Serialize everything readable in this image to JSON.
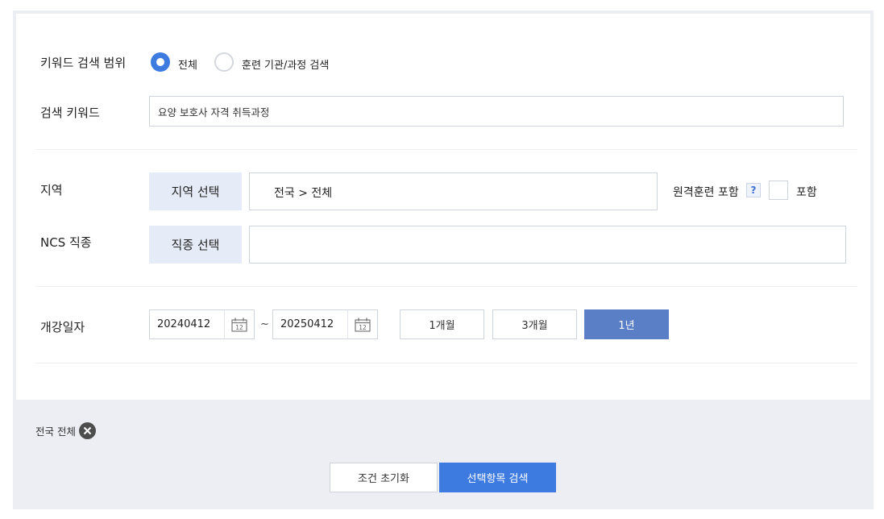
{
  "scope": {
    "label": "키워드 검색 범위",
    "options": [
      {
        "label": "전체",
        "selected": true
      },
      {
        "label": "훈련 기관/과정 검색",
        "selected": false
      }
    ]
  },
  "keyword": {
    "label": "검색 키워드",
    "value": "요양 보호사 자격 취득과정"
  },
  "region": {
    "label": "지역",
    "button": "지역 선택",
    "value": "전국 > 전체",
    "remote_label": "원격훈련 포함",
    "help": "?",
    "include_label": "포함"
  },
  "ncs": {
    "label": "NCS 직종",
    "button": "직종 선택",
    "value": ""
  },
  "date": {
    "label": "개강일자",
    "start": "20240412",
    "end": "20250412",
    "separator": "~",
    "periods": [
      {
        "label": "1개월",
        "active": false
      },
      {
        "label": "3개월",
        "active": false
      },
      {
        "label": "1년",
        "active": true
      }
    ]
  },
  "selected_tag": {
    "label": "전국 전체"
  },
  "footer": {
    "reset_label": "조건 초기화",
    "search_label": "선택항목 검색"
  },
  "colors": {
    "accent": "#3d7be0",
    "active_period": "#5b7fc6",
    "select_button_bg": "#e6ecf7",
    "frame": "#eceef3"
  }
}
